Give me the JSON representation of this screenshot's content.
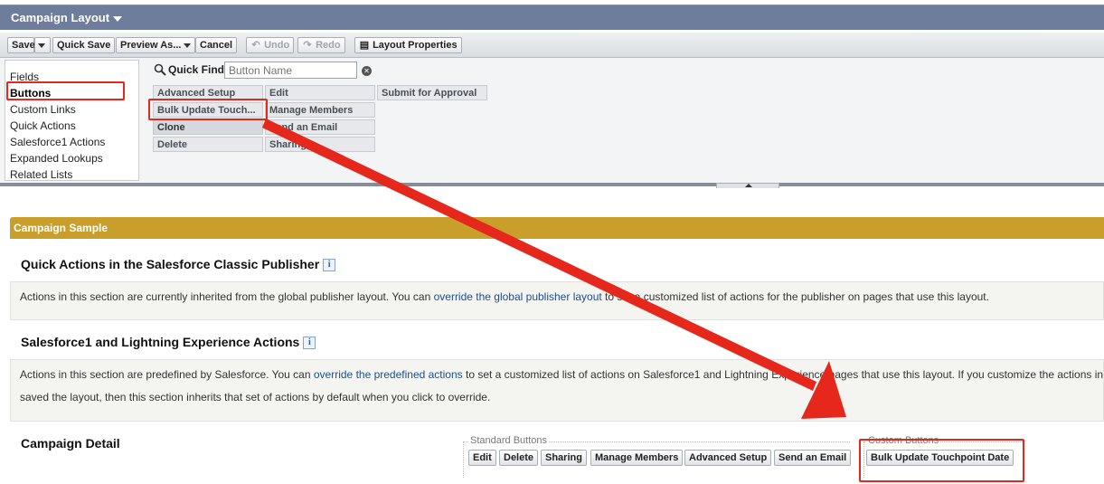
{
  "title": {
    "label": "Campaign Layout"
  },
  "toolbar": {
    "save": "Save",
    "quick_save": "Quick Save",
    "preview_as": "Preview As...",
    "cancel": "Cancel",
    "undo": "Undo",
    "redo": "Redo",
    "layout_properties": "Layout Properties"
  },
  "sidebar": {
    "items": [
      "Fields",
      "Buttons",
      "Custom Links",
      "Quick Actions",
      "Salesforce1 Actions",
      "Expanded Lookups",
      "Related Lists"
    ],
    "selected": "Buttons"
  },
  "quick_find": {
    "label": "Quick Find",
    "placeholder": "Button Name"
  },
  "palette_buttons": {
    "col1": [
      "Advanced Setup",
      "Bulk Update Touch...",
      "Clone",
      "Delete"
    ],
    "col2": [
      "Edit",
      "Manage Members",
      "Send an Email",
      "Sharing"
    ],
    "col3": [
      "Submit for Approval"
    ]
  },
  "layout": {
    "section_title": "Campaign Sample",
    "classic_publisher": {
      "heading": "Quick Actions in the Salesforce Classic Publisher",
      "text_before": "Actions in this section are currently inherited from the global publisher layout. You can ",
      "link": "override the global publisher layout",
      "text_after": " to set a customized list of actions for the publisher on pages that use this layout."
    },
    "sf1_actions": {
      "heading": "Salesforce1 and Lightning Experience Actions",
      "text_before": "Actions in this section are predefined by Salesforce. You can ",
      "link": "override the predefined actions",
      "text_after": " to set a customized list of actions on Salesforce1 and Lightning Experience pages that use this layout. If you customize the actions in",
      "text_line2": "saved the layout, then this section inherits that set of actions by default when you click to override."
    },
    "campaign_detail": {
      "heading": "Campaign Detail",
      "standard_label": "Standard Buttons",
      "standard_buttons": [
        "Edit",
        "Delete",
        "Sharing",
        "Manage Members",
        "Advanced Setup",
        "Send an Email"
      ],
      "custom_label": "Custom Buttons",
      "custom_buttons": [
        "Bulk Update Touchpoint Date"
      ]
    }
  },
  "annotation_color": "#e5281b"
}
